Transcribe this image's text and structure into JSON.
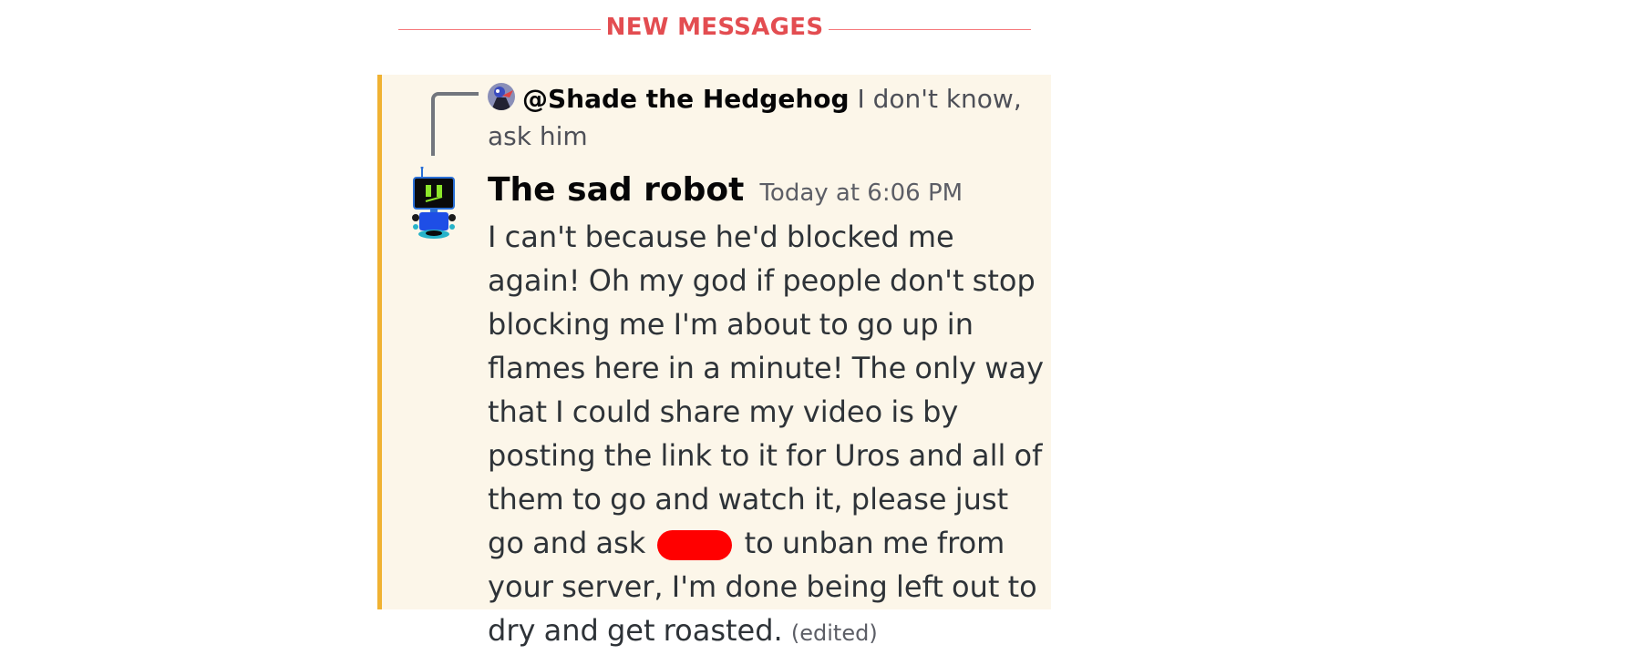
{
  "divider": {
    "label": "NEW MESSAGES",
    "color": "#f23f43"
  },
  "reply": {
    "mention": "@Shade the Hedgehog",
    "preview": "I don't know, ask him"
  },
  "message": {
    "username": "The sad robot",
    "timestamp": "Today at 6:06 PM",
    "text_before_redaction": "I can't because he'd blocked me again! Oh my god if people don't stop blocking me I'm about to go up in flames here in a minute! The only way that I could share my video is by posting the link to it for Uros and all of them to go and watch it, please just go and ask",
    "text_after_redaction": "to unban me from your server, I'm done being left out to dry and get roasted.",
    "edited_label": "(edited)",
    "highlight_color": "#fcf6e9",
    "accent_color": "#f0b232"
  },
  "icons": {
    "reply_avatar": "shade-avatar-icon",
    "author_avatar": "robot-avatar-icon",
    "redaction": "red-scribble"
  }
}
